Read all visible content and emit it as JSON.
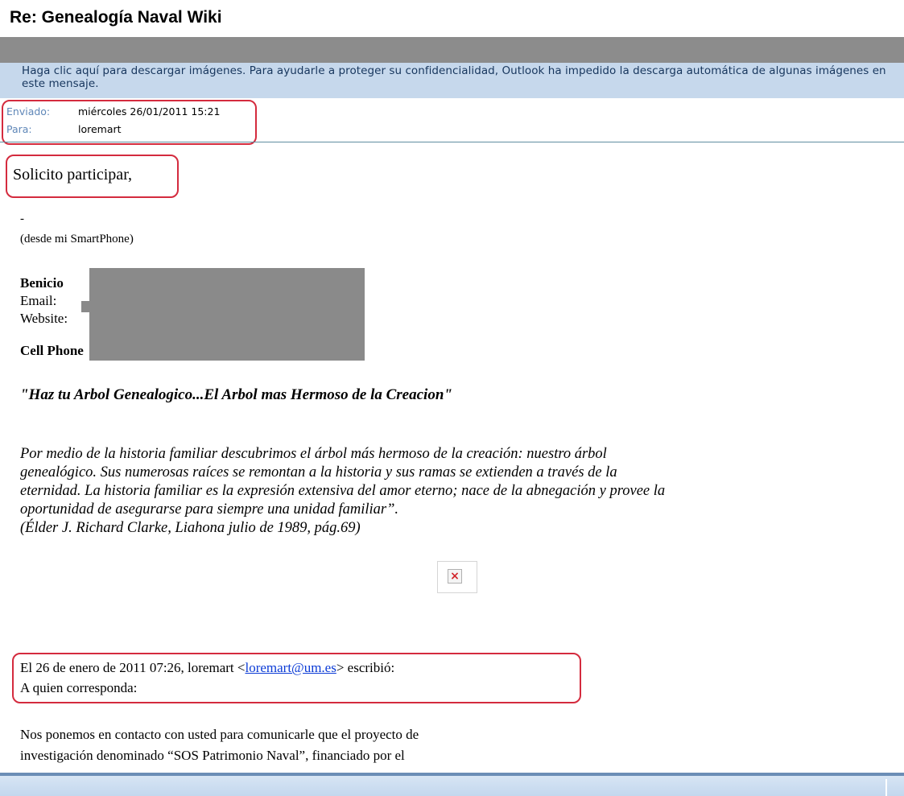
{
  "window": {
    "title": "Re: Genealogía Naval Wiki"
  },
  "infobar": {
    "text": "Haga clic aquí para descargar imágenes. Para ayudarle a proteger su confidencialidad, Outlook ha impedido la descarga automática de algunas imágenes en este mensaje."
  },
  "header": {
    "sent_label": "Enviado:",
    "sent_value": "miércoles 26/01/2011 15:21",
    "to_label": "Para:",
    "to_value": "loremart"
  },
  "message": {
    "greeting": "Solicito participar,",
    "dash": "-",
    "device_note": "(desde mi SmartPhone)",
    "signature": {
      "name": "Benicio",
      "email_label": "Email:",
      "website_label": "Website:",
      "cell_label": "Cell Phone"
    },
    "quote_title": "\"Haz tu Arbol Genealogico...El Arbol mas Hermoso de la Creacion\"",
    "quote_lines": [
      "Por medio de la historia familiar descubrimos el árbol más hermoso de la creación: nuestro árbol",
      "genealógico. Sus numerosas raíces se remontan a la historia y sus ramas se extienden a través de la",
      "eternidad. La historia familiar es la expresión extensiva del amor eterno; nace de la abnegación y provee la",
      "oportunidad de asegurarse para siempre una unidad familiar”.",
      "(Élder J. Richard Clarke, Liahona julio de 1989, pág.69)"
    ],
    "image_placeholder_icon": "broken-image-x-icon",
    "quoted": {
      "intro_prefix": "El 26 de enero de 2011 07:26, loremart <",
      "email_link": "loremart@um.es",
      "intro_suffix": "> escribió:",
      "salutation": "A quien corresponda:",
      "line1": "Nos ponemos en contacto con usted para comunicarle que el proyecto de",
      "line2": "investigación denominado “SOS Patrimonio Naval”, financiado por el"
    }
  },
  "colors": {
    "infobar_bg": "#c6d8ec",
    "infobar_text": "#17365d",
    "header_label": "#5f87b8",
    "annotation_red": "#d42b3e",
    "redaction_gray": "#8a8a8a",
    "link_blue": "#0b3bd6"
  }
}
